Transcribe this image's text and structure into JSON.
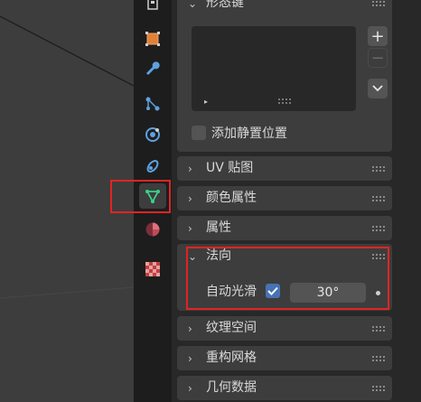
{
  "tabs": [
    {
      "icon": "object-icon",
      "color": "#e0813b"
    },
    {
      "icon": "modifier-wrench-icon",
      "color": "#5ea0e0"
    },
    {
      "icon": "particles-icon",
      "color": "#5ea0e0"
    },
    {
      "icon": "physics-icon",
      "color": "#5ea0e0"
    },
    {
      "icon": "constraints-icon",
      "color": "#5ea0e0"
    },
    {
      "icon": "mesh-data-icon",
      "color": "#3ad18a",
      "active": true
    },
    {
      "icon": "material-icon",
      "color": "#e0707a"
    },
    {
      "icon": "texture-checker-icon",
      "color": "#c04040"
    }
  ],
  "shape_keys": {
    "title": "形态键",
    "add_button": "+",
    "remove_button": "−",
    "play_icon": "▸",
    "relative_checkbox_label": "添加静置位置",
    "relative_checked": false
  },
  "sections": [
    {
      "label": "UV 贴图",
      "expanded": false
    },
    {
      "label": "颜色属性",
      "expanded": false
    },
    {
      "label": "属性",
      "expanded": false
    },
    {
      "label": "法向",
      "expanded": true
    },
    {
      "label": "纹理空间",
      "expanded": false
    },
    {
      "label": "重构网格",
      "expanded": false
    },
    {
      "label": "几何数据",
      "expanded": false
    }
  ],
  "normals": {
    "auto_smooth_label": "自动光滑",
    "auto_smooth_checked": true,
    "angle_value": "30°"
  },
  "chevron_collapsed": "›",
  "chevron_expanded": "⌄",
  "colors": {
    "highlight": "#e02424",
    "checkbox_on": "#4772b3",
    "panel_bg": "#3d3d3d",
    "editor_bg": "#282828",
    "tabbar_bg": "#1d1d1d"
  }
}
